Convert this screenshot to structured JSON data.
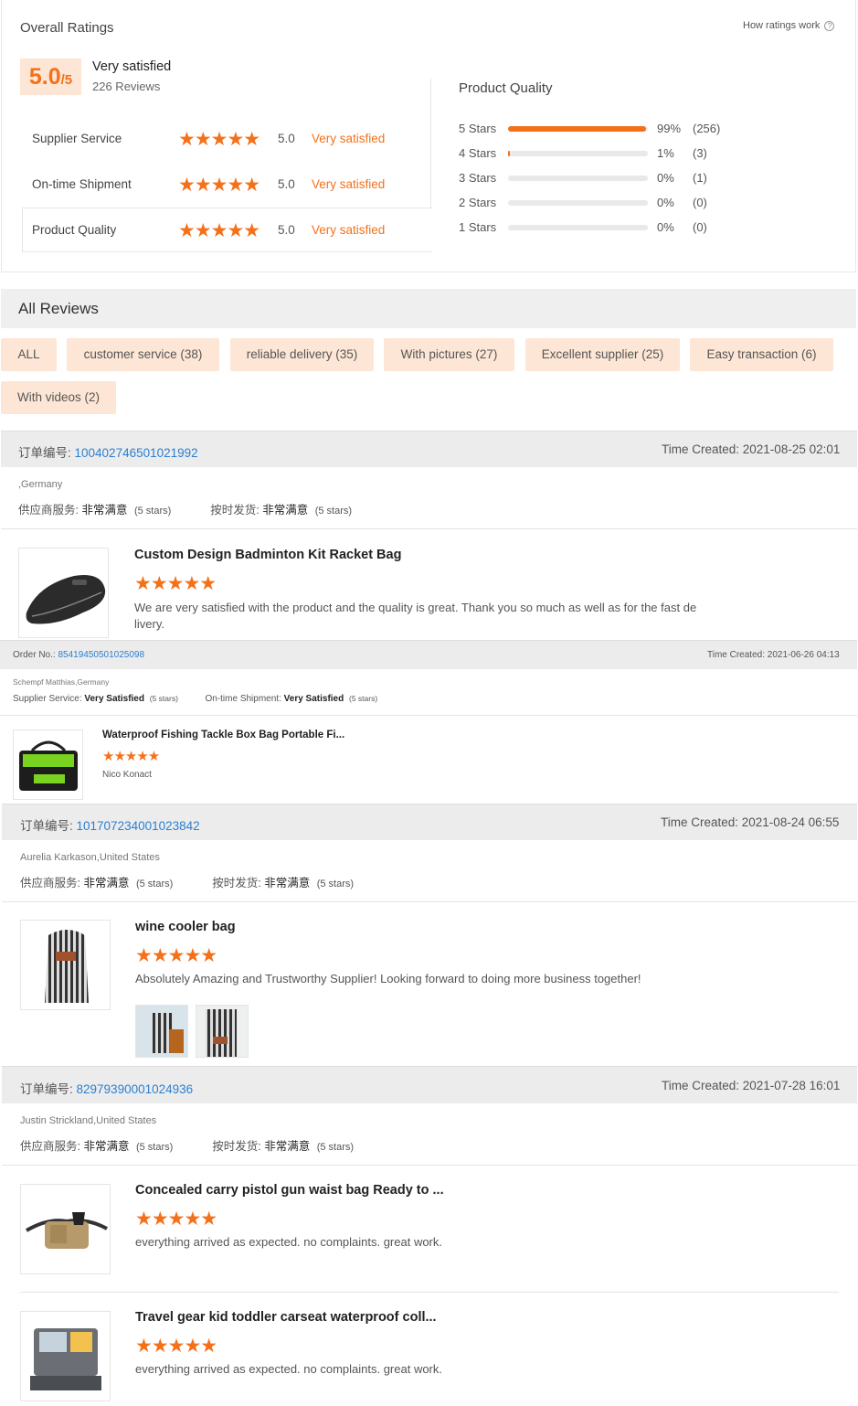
{
  "overall": {
    "title": "Overall Ratings",
    "how_ratings_work": "How ratings work",
    "score_big": "5.0",
    "score_small": "/5",
    "summary": "Very satisfied",
    "reviews_count": "226 Reviews",
    "rows": [
      {
        "label": "Supplier Service",
        "num": "5.0",
        "desc": "Very satisfied"
      },
      {
        "label": "On-time Shipment",
        "num": "5.0",
        "desc": "Very satisfied"
      },
      {
        "label": "Product Quality",
        "num": "5.0",
        "desc": "Very satisfied"
      }
    ],
    "stars": "★★★★★"
  },
  "quality": {
    "title": "Product Quality",
    "rows": [
      {
        "label": "5  Stars",
        "fill": 0.99,
        "pct": "99%",
        "count": "(256)"
      },
      {
        "label": "4  Stars",
        "fill": 0.01,
        "pct": "1%",
        "count": "(3)"
      },
      {
        "label": "3  Stars",
        "fill": 0,
        "pct": "0%",
        "count": "(1)"
      },
      {
        "label": "2  Stars",
        "fill": 0,
        "pct": "0%",
        "count": "(0)"
      },
      {
        "label": "1  Stars",
        "fill": 0,
        "pct": "0%",
        "count": "(0)"
      }
    ]
  },
  "all_reviews": {
    "title": "All Reviews",
    "tags": [
      "ALL",
      "customer service (38)",
      "reliable delivery (35)",
      "With pictures (27)",
      "Excellent supplier (25)",
      "Easy transaction (6)",
      "With videos (2)"
    ]
  },
  "colors": {
    "accent": "#f4711a",
    "link": "#2b7fd0",
    "tag_bg": "#fde6d5"
  },
  "reviews": [
    {
      "order_label": "订单编号: ",
      "order_no": "100402746501021992",
      "time": "Time Created: 2021-08-25 02:01",
      "reviewer": ",Germany",
      "supplier_label": "供应商服务: ",
      "supplier_value": "非常满意",
      "supplier_stars": "(5 stars)",
      "ship_label": "按时发货: ",
      "ship_value": "非常满意",
      "ship_stars": "(5 stars)",
      "items": [
        {
          "title": "Custom Design Badminton Kit Racket Bag",
          "text1": "We are very satisfied with the product and the quality is great. Thank you so much as well as for the fast de",
          "text2": "livery.",
          "image": "racket-bag"
        }
      ]
    },
    {
      "order_label": "Order No.: ",
      "order_no": "85419450501025098",
      "time": "Time Created: 2021-06-26 04:13",
      "reviewer": "Schempf Matthias,Germany",
      "supplier_label": "Supplier Service: ",
      "supplier_value": "Very Satisfied",
      "supplier_stars": "(5 stars)",
      "ship_label": "On-time Shipment: ",
      "ship_value": "Very Satisfied",
      "ship_stars": "(5 stars)",
      "items": [
        {
          "title": "Waterproof Fishing Tackle Box Bag Portable Fi...",
          "text1": "Nico Konact",
          "image": "tackle-bag"
        }
      ]
    },
    {
      "order_label": "订单编号: ",
      "order_no": "101707234001023842",
      "time": "Time Created: 2021-08-24 06:55",
      "reviewer": "Aurelia Karkason,United States",
      "supplier_label": "供应商服务: ",
      "supplier_value": "非常满意",
      "supplier_stars": "(5 stars)",
      "ship_label": "按时发货: ",
      "ship_value": "非常满意",
      "ship_stars": "(5 stars)",
      "items": [
        {
          "title": "wine cooler bag",
          "text1": "Absolutely Amazing and Trustworthy Supplier! Looking forward to doing more business together!",
          "image": "wine-bag"
        }
      ]
    },
    {
      "order_label": "订单编号: ",
      "order_no": "82979390001024936",
      "time": "Time Created: 2021-07-28 16:01",
      "reviewer": "Justin Strickland,United States",
      "supplier_label": "供应商服务: ",
      "supplier_value": "非常满意",
      "supplier_stars": "(5 stars)",
      "ship_label": "按时发货: ",
      "ship_value": "非常满意",
      "ship_stars": "(5 stars)",
      "items": [
        {
          "title": "Concealed carry pistol gun waist bag Ready to ...",
          "text1": "everything arrived as expected. no complaints. great work.",
          "image": "waist-bag"
        },
        {
          "title": "Travel gear kid toddler carseat waterproof coll...",
          "text1": "everything arrived as expected. no complaints. great work.",
          "image": "tray"
        }
      ]
    }
  ]
}
